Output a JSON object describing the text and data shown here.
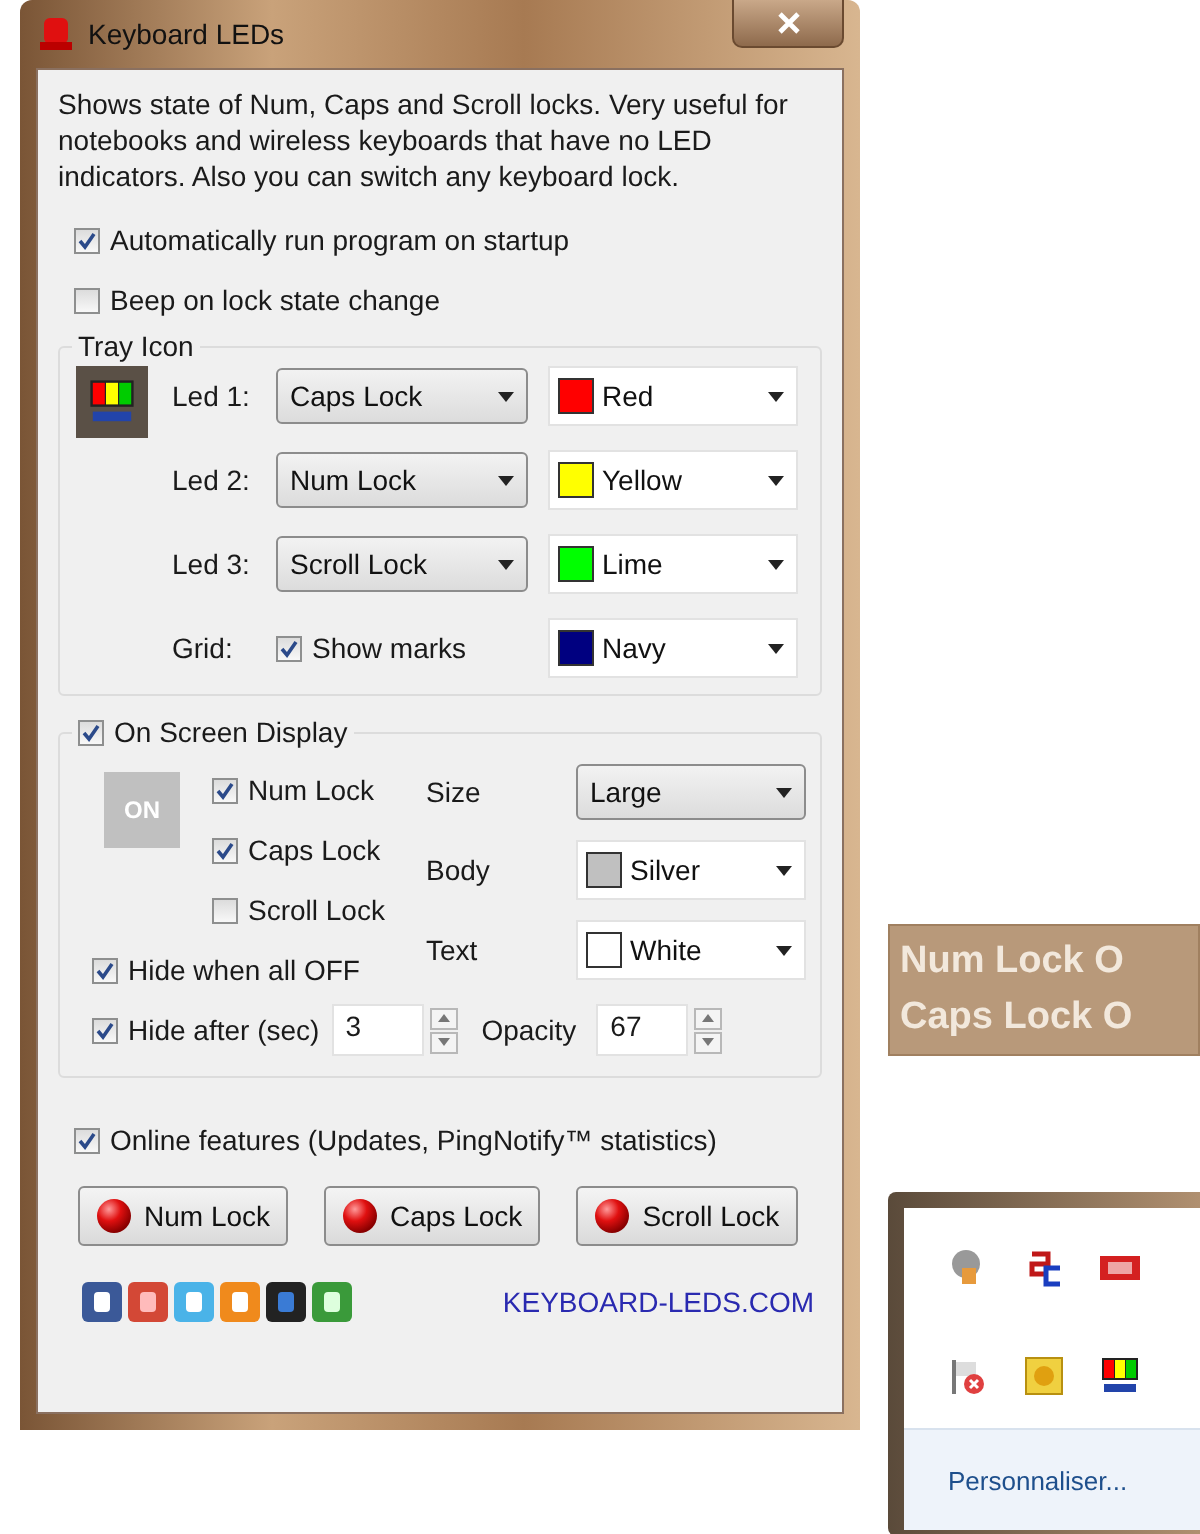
{
  "window": {
    "title": "Keyboard LEDs",
    "description": "Shows state of Num, Caps and Scroll locks. Very useful for notebooks and wireless keyboards that have no LED indicators. Also you can switch any keyboard lock."
  },
  "options": [
    {
      "label": "Automatically run program on startup",
      "checked": true
    },
    {
      "label": "Beep on lock state change",
      "checked": false
    }
  ],
  "tray_icon": {
    "title": "Tray Icon",
    "leds": [
      {
        "label": "Led 1:",
        "lock": "Caps Lock",
        "color_name": "Red",
        "color": "#ff0000"
      },
      {
        "label": "Led 2:",
        "lock": "Num Lock",
        "color_name": "Yellow",
        "color": "#ffff00"
      },
      {
        "label": "Led 3:",
        "lock": "Scroll Lock",
        "color_name": "Lime",
        "color": "#00ff00"
      }
    ],
    "grid": {
      "label": "Grid:",
      "show_marks": "Show marks",
      "checked": true,
      "color_name": "Navy",
      "color": "#000080"
    }
  },
  "osd": {
    "label": "On Screen Display",
    "checked": true,
    "preview": "ON",
    "locks": [
      {
        "label": "Num Lock",
        "checked": true
      },
      {
        "label": "Caps Lock",
        "checked": true
      },
      {
        "label": "Scroll Lock",
        "checked": false
      }
    ],
    "hide_all_off": {
      "label": "Hide when all OFF",
      "checked": true
    },
    "hide_after": {
      "label": "Hide after (sec)",
      "checked": true,
      "value": "3"
    },
    "size": {
      "label": "Size",
      "value": "Large"
    },
    "body": {
      "label": "Body",
      "color_name": "Silver",
      "color": "#c0c0c0"
    },
    "text": {
      "label": "Text",
      "color_name": "White",
      "color": "#ffffff"
    },
    "opacity": {
      "label": "Opacity",
      "value": "67"
    }
  },
  "online": {
    "label": "Online features (Updates, PingNotify™ statistics)",
    "checked": true
  },
  "lock_buttons": [
    "Num Lock",
    "Caps Lock",
    "Scroll Lock"
  ],
  "website": "KEYBOARD-LEDS.COM",
  "osd_preview": {
    "lines": [
      "Num Lock O",
      "Caps Lock O"
    ]
  },
  "tray_popup": {
    "link": "Personnaliser..."
  }
}
